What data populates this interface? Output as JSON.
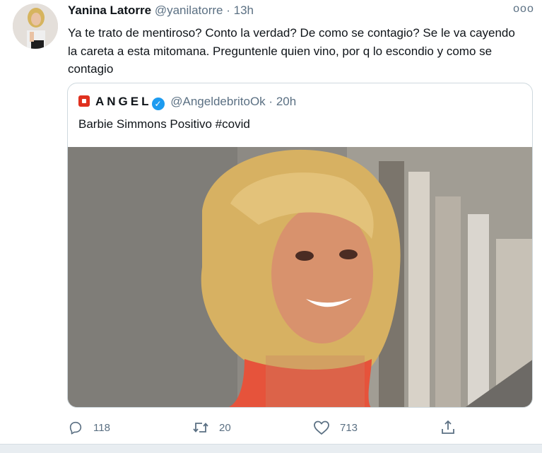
{
  "tweet": {
    "author_name": "Yanina Latorre",
    "author_handle": "@yanilatorre",
    "separator": "·",
    "time": "13h",
    "more": "ooo",
    "text": "Ya te trato de mentiroso? Conto la verdad? De como se contagio? Se le va cayendo la careta a esta mitomana. Preguntenle quien vino, por q lo escondio y como se contagio"
  },
  "quoted": {
    "author_name": "ANGEL",
    "author_handle": "@AngeldebritoOk",
    "separator": "·",
    "time": "20h",
    "text": "Barbie Simmons Positivo #covid"
  },
  "actions": {
    "replies": "118",
    "retweets": "20",
    "likes": "713"
  },
  "colors": {
    "muted": "#5b7083",
    "verified": "#1d9bf0",
    "logo": "#e0311f",
    "border": "#cfd9de"
  },
  "icons": [
    "reply-icon",
    "retweet-icon",
    "like-icon",
    "share-icon",
    "verified-icon",
    "more-icon"
  ]
}
